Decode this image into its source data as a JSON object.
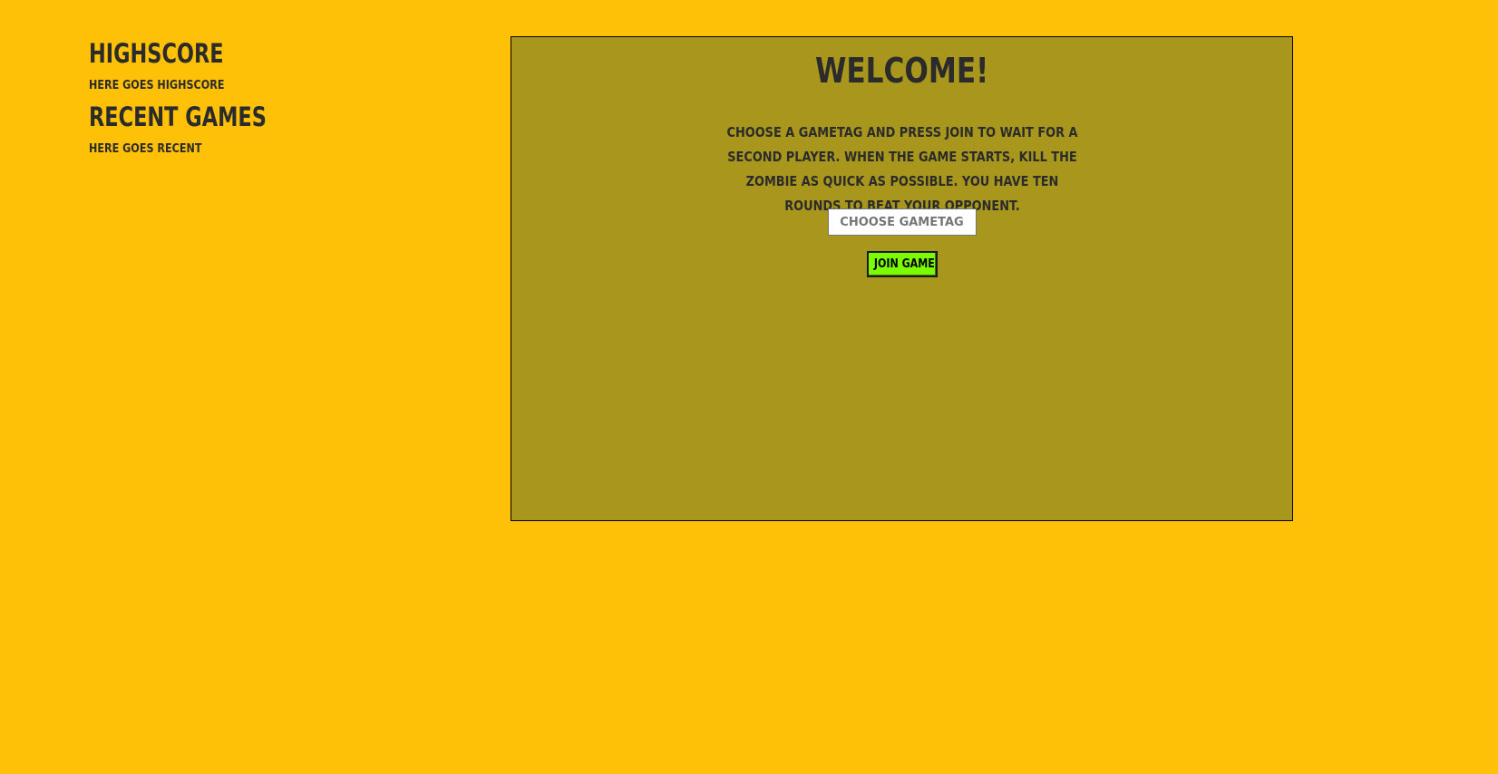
{
  "sidebar": {
    "highscore_title": "Highscore",
    "highscore_text": "Here goes highscore",
    "recent_title": "Recent games",
    "recent_text": "Here goes recent"
  },
  "main": {
    "title": "Welcome!",
    "instructions": "Choose a gametag and press join to wait for a second player. When the game starts, kill the zombie as quick as possible. You have ten rounds to beat your opponent.",
    "gametag_placeholder": "Choose gametag",
    "gametag_value": "",
    "join_label": "Join game"
  },
  "colors": {
    "page_background": "#ffc107",
    "panel_background": "#a8971c",
    "button_background": "#7cfc00",
    "text": "#2b2b2b"
  }
}
